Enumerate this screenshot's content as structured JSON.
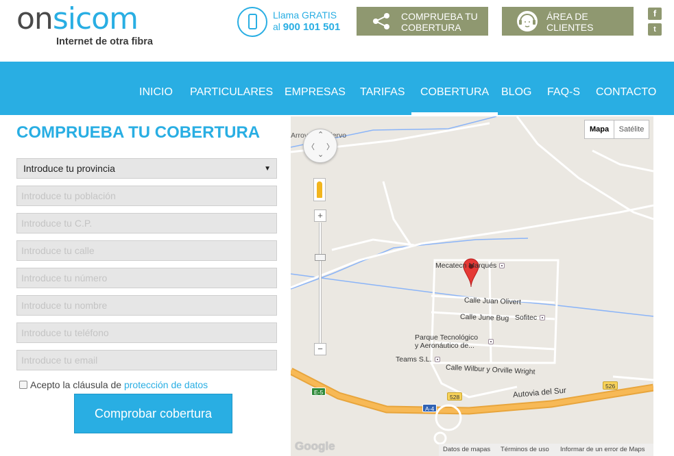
{
  "header": {
    "logo_part1": "on",
    "logo_part2": "sicom",
    "logo_tagline": "Internet de otra fibra",
    "call_line1": "Llama GRATIS",
    "call_prefix": "al",
    "call_number": "900 101 501",
    "btn_coverage": "COMPRUEBA TU\nCOBERTURA",
    "btn_clients": "ÁREA DE\nCLIENTES",
    "social_facebook": "f",
    "social_twitter": "t",
    "icons": [
      "phone-icon",
      "share-icon",
      "customer-agent-icon",
      "facebook-icon",
      "twitter-icon"
    ],
    "accent_color": "#29aee3",
    "button_color": "#8f9870"
  },
  "nav": {
    "items": [
      "INICIO",
      "PARTICULARES",
      "EMPRESAS",
      "TARIFAS",
      "COBERTURA",
      "BLOG",
      "FAQ-S",
      "CONTACTO"
    ],
    "active": "COBERTURA"
  },
  "form": {
    "title": "COMPRUEBA TU COBERTURA",
    "province_selected": "Introduce tu provincia",
    "placeholders": {
      "poblacion": "Introduce tu población",
      "cp": "Introduce tu C.P.",
      "calle": "Introduce tu calle",
      "numero": "Introduce tu número",
      "nombre": "Introduce tu nombre",
      "telefono": "Introduce tu teléfono",
      "email": "Introduce tu email"
    },
    "accept_text": "Acepto la cláusula de",
    "accept_link": "protección de datos",
    "accept_checked": false,
    "submit": "Comprobar cobertura"
  },
  "map": {
    "type_map": "Mapa",
    "type_satellite": "Satélite",
    "selected_type": "Mapa",
    "zoom_in": "+",
    "zoom_out": "−",
    "labels": {
      "arroyo": "Arroyo del Ciervo",
      "mecatec": "Mecatecn Marqués",
      "juan_olivert": "Calle Juan Olivert",
      "june_bug": "Calle June Bug",
      "sofitec": "Sofitec",
      "parque1": "Parque Tecnológico",
      "parque2": "y Aeronáutico de...",
      "teams": "Teams S.L.",
      "wilbur": "Calle Wilbur y Orville Wright",
      "autovia": "Autovia del Sur"
    },
    "shields": {
      "e5": "E-5",
      "r528a": "528",
      "a4": "A-4",
      "r526": "526"
    },
    "google": "Google",
    "footer_data": "Datos de mapas",
    "footer_terms": "Términos de uso",
    "footer_report": "Informar de un error de Maps"
  }
}
